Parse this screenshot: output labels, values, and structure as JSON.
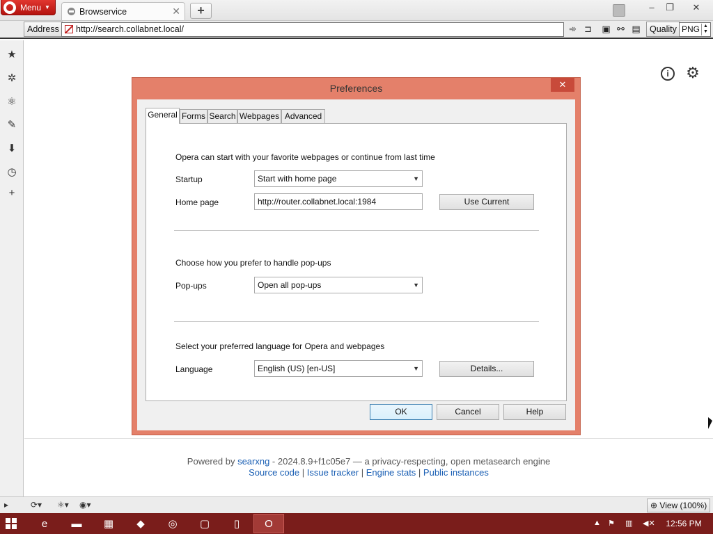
{
  "browser": {
    "menu_label": "Menu",
    "tab_title": "Browservice",
    "address_label": "Address",
    "url": "http://search.collabnet.local/",
    "quality_label": "Quality",
    "quality_value": "PNG"
  },
  "dialog": {
    "title": "Preferences",
    "tabs": [
      "General",
      "Forms",
      "Search",
      "Webpages",
      "Advanced"
    ],
    "active_tab": "General",
    "startup_section": "Opera can start with your favorite webpages or continue from last time",
    "startup_label": "Startup",
    "startup_value": "Start with home page",
    "homepage_label": "Home page",
    "homepage_value": "http://router.collabnet.local:1984",
    "use_current_label": "Use Current",
    "popups_section": "Choose how you prefer to handle pop-ups",
    "popups_label": "Pop-ups",
    "popups_value": "Open all pop-ups",
    "language_section": "Select your preferred language for Opera and webpages",
    "language_label": "Language",
    "language_value": "English (US) [en-US]",
    "details_label": "Details...",
    "ok_label": "OK",
    "cancel_label": "Cancel",
    "help_label": "Help"
  },
  "footer": {
    "powered_prefix": "Powered by ",
    "powered_link": "searxng",
    "powered_suffix": " - 2024.8.9+f1c05e7 — a privacy-respecting, open metasearch engine",
    "links": [
      "Source code",
      "Issue tracker",
      "Engine stats",
      "Public instances"
    ],
    "separator": " | "
  },
  "statusbar": {
    "view_label": "View (100%)"
  },
  "taskbar": {
    "clock": "12:56 PM"
  },
  "icons": {
    "sidebar": [
      "bookmarks-icon",
      "settings-icon",
      "unite-icon",
      "notes-icon",
      "downloads-icon",
      "history-icon",
      "add-panel-icon"
    ]
  },
  "colors": {
    "dialog_frame": "#e4806a",
    "taskbar": "#7a1d1b",
    "opera_red": "#cc1f18",
    "link": "#1a5fb4"
  }
}
